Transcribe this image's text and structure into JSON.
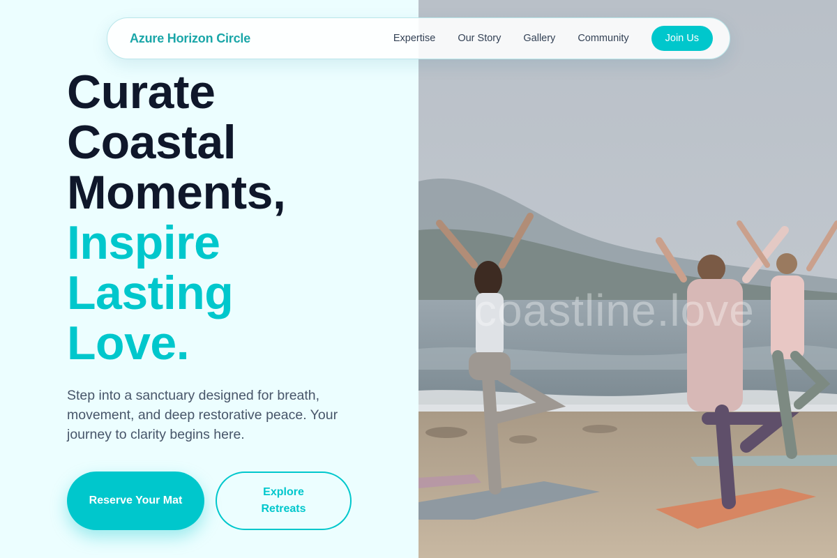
{
  "nav": {
    "brand": "Azure Horizon Circle",
    "links": [
      "Expertise",
      "Our Story",
      "Gallery",
      "Community"
    ],
    "cta": "Join Us"
  },
  "hero": {
    "title_dark": [
      "Curate",
      "Coastal",
      "Moments,"
    ],
    "title_accent": [
      "Inspire",
      "Lasting",
      "Love."
    ],
    "subtitle": "Step into a sanctuary designed for breath, movement, and deep restorative peace. Your journey to clarity begins here.",
    "primary_cta": "Reserve Your Mat",
    "secondary_cta": "Explore Retreats"
  },
  "image": {
    "watermark": "coastline.love",
    "subject": "beach-yoga-photo"
  },
  "colors": {
    "accent": "#00c7cc",
    "heading": "#0f172a",
    "body_text": "#475569",
    "background": "#ecfeff"
  }
}
